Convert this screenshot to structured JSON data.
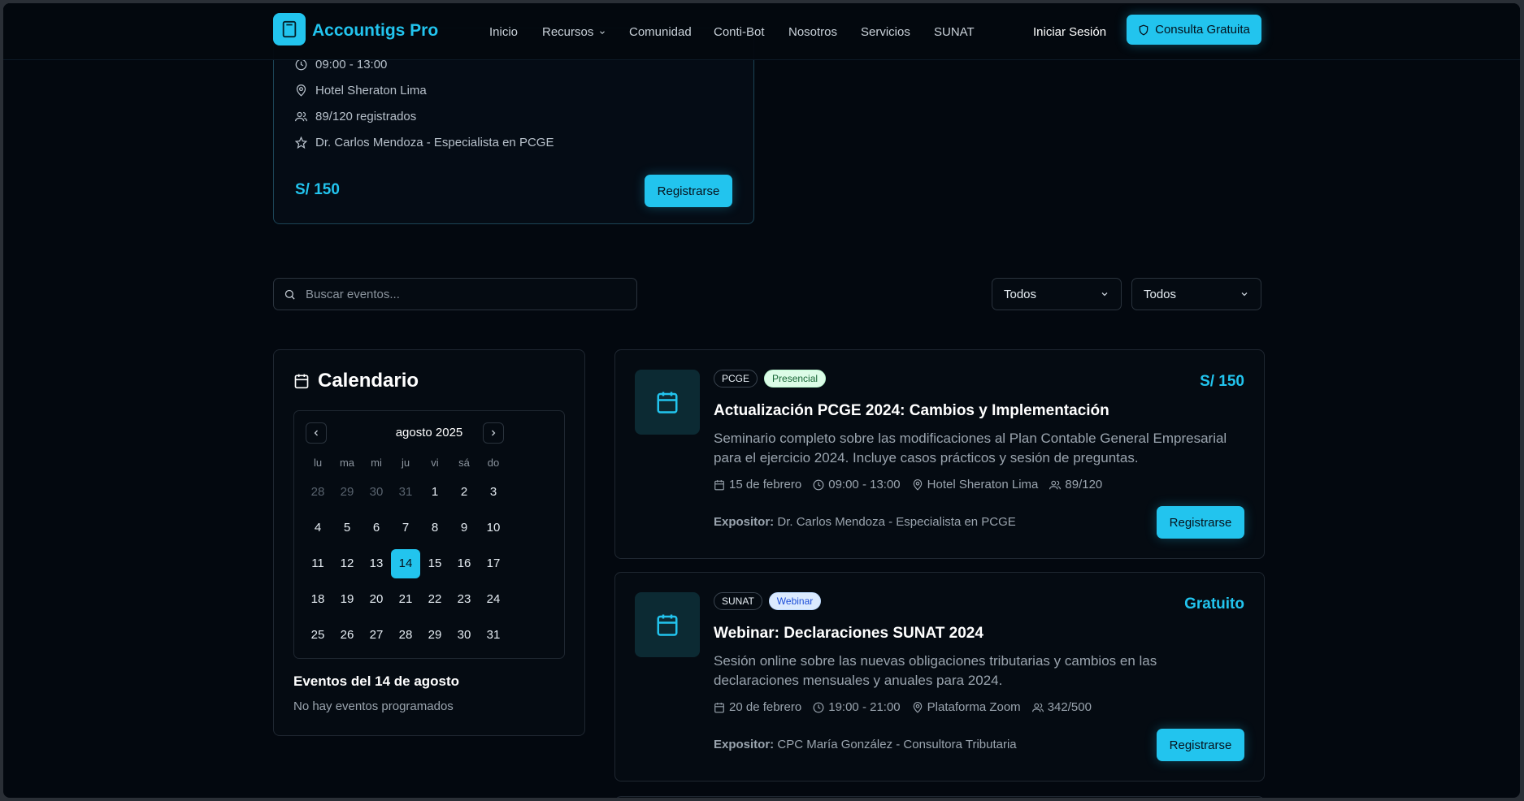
{
  "brand": {
    "name": "Accountigs Pro",
    "accent": "#22c4ee"
  },
  "nav": {
    "items": [
      {
        "label": "Inicio"
      },
      {
        "label": "Recursos"
      },
      {
        "label": "Comunidad"
      },
      {
        "label": "Conti-Bot"
      },
      {
        "label": "Nosotros"
      },
      {
        "label": "Servicios"
      },
      {
        "label": "SUNAT"
      }
    ],
    "login": "Iniciar Sesión",
    "cta": "Consulta Gratuita"
  },
  "top_card": {
    "time": "09:00 - 13:00",
    "location": "Hotel Sheraton Lima",
    "registered": "89/120 registrados",
    "speaker": "Dr. Carlos Mendoza - Especialista en PCGE",
    "price": "S/ 150",
    "button": "Registrarse"
  },
  "search": {
    "placeholder": "Buscar eventos..."
  },
  "filters": [
    {
      "value": "Todos"
    },
    {
      "value": "Todos"
    }
  ],
  "calendar": {
    "title": "Calendario",
    "month": "agosto 2025",
    "weekdays": [
      "lu",
      "ma",
      "mi",
      "ju",
      "vi",
      "sá",
      "do"
    ],
    "weeks": [
      [
        "28",
        "29",
        "30",
        "31",
        "1",
        "2",
        "3"
      ],
      [
        "4",
        "5",
        "6",
        "7",
        "8",
        "9",
        "10"
      ],
      [
        "11",
        "12",
        "13",
        "14",
        "15",
        "16",
        "17"
      ],
      [
        "18",
        "19",
        "20",
        "21",
        "22",
        "23",
        "24"
      ],
      [
        "25",
        "26",
        "27",
        "28",
        "29",
        "30",
        "31"
      ]
    ],
    "selected_day": "14",
    "events_title": "Eventos del 14 de agosto",
    "events_empty": "No hay eventos programados"
  },
  "events": [
    {
      "category": "PCGE",
      "mode": "Presencial",
      "price": "S/ 150",
      "title": "Actualización PCGE 2024: Cambios y Implementación",
      "description": "Seminario completo sobre las modificaciones al Plan Contable General Empresarial para el ejercicio 2024. Incluye casos prácticos y sesión de preguntas.",
      "date": "15 de febrero",
      "time": "09:00 - 13:00",
      "location": "Hotel Sheraton Lima",
      "capacity": "89/120",
      "speaker_label": "Expositor:",
      "speaker": "Dr. Carlos Mendoza - Especialista en PCGE",
      "button": "Registrarse"
    },
    {
      "category": "SUNAT",
      "mode": "Webinar",
      "price": "Gratuito",
      "title": "Webinar: Declaraciones SUNAT 2024",
      "description": "Sesión online sobre las nuevas obligaciones tributarias y cambios en las declaraciones mensuales y anuales para 2024.",
      "date": "20 de febrero",
      "time": "19:00 - 21:00",
      "location": "Plataforma Zoom",
      "capacity": "342/500",
      "speaker_label": "Expositor:",
      "speaker": "CPC María González - Consultora Tributaria",
      "button": "Registrarse"
    }
  ]
}
